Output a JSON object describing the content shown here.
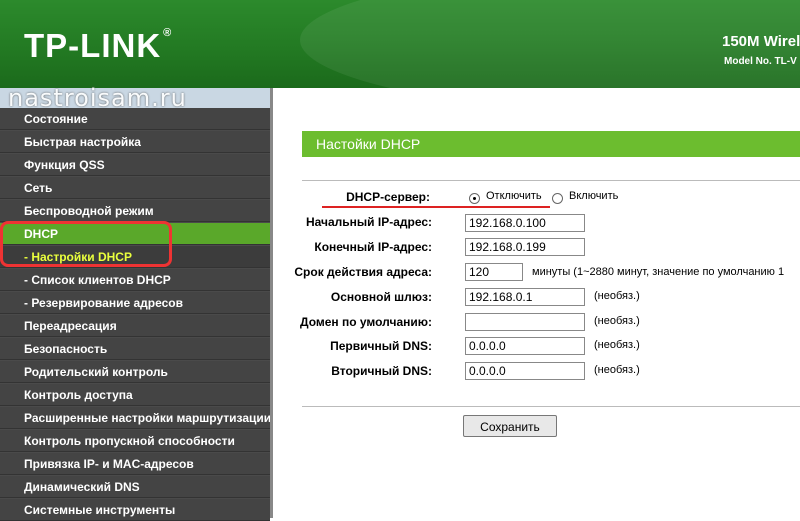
{
  "header": {
    "logo_text": "TP-LINK",
    "logo_mark": "®",
    "model_title": "150M Wirel",
    "model_no": "Model No. TL-V"
  },
  "watermark": "nastroisam.ru",
  "sidebar": {
    "items": [
      {
        "label": "Состояние"
      },
      {
        "label": "Быстрая настройка"
      },
      {
        "label": "Функция QSS"
      },
      {
        "label": "Сеть"
      },
      {
        "label": "Беспроводной режим"
      },
      {
        "label": "DHCP"
      },
      {
        "label": "- Настройки DHCP"
      },
      {
        "label": "- Список клиентов DHCP"
      },
      {
        "label": "- Резервирование адресов"
      },
      {
        "label": "Переадресация"
      },
      {
        "label": "Безопасность"
      },
      {
        "label": "Родительский контроль"
      },
      {
        "label": "Контроль доступа"
      },
      {
        "label": "Расширенные настройки маршрутизации"
      },
      {
        "label": "Контроль пропускной способности"
      },
      {
        "label": "Привязка IP- и MAC-адресов"
      },
      {
        "label": "Динамический DNS"
      },
      {
        "label": "Системные инструменты"
      }
    ]
  },
  "section_title": "Настойки DHCP",
  "form": {
    "dhcp_server_label": "DHCP-сервер:",
    "disable_label": "Отключить",
    "enable_label": "Включить",
    "start_ip_label": "Начальный IP-адрес:",
    "start_ip_value": "192.168.0.100",
    "end_ip_label": "Конечный IP-адрес:",
    "end_ip_value": "192.168.0.199",
    "lease_label": "Срок действия адреса:",
    "lease_value": "120",
    "lease_note": "минуты (1~2880 минут, значение по умолчанию 1",
    "gateway_label": "Основной шлюз:",
    "gateway_value": "192.168.0.1",
    "domain_label": "Домен по умолчанию:",
    "domain_value": "",
    "dns1_label": "Первичный DNS:",
    "dns1_value": "0.0.0.0",
    "dns2_label": "Вторичный DNS:",
    "dns2_value": "0.0.0.0",
    "optional_note": "(необяз.)",
    "save_label": "Сохранить"
  }
}
